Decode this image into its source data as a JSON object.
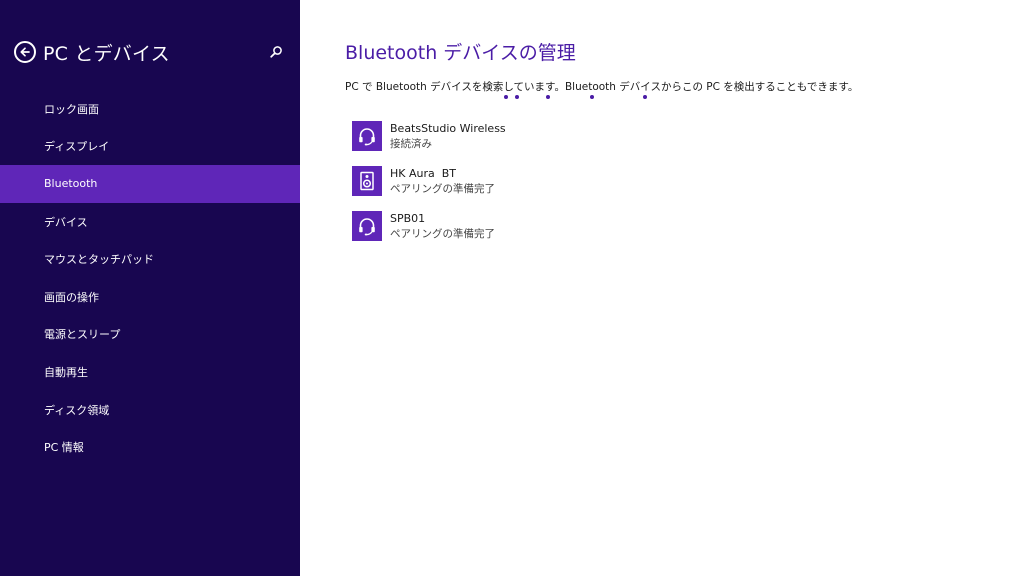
{
  "sidebar": {
    "title": "PC とデバイス",
    "back_icon": "back-arrow-circle-icon",
    "search_icon": "search-icon",
    "items": [
      {
        "label": "ロック画面"
      },
      {
        "label": "ディスプレイ"
      },
      {
        "label": "Bluetooth",
        "selected": true
      },
      {
        "label": "デバイス"
      },
      {
        "label": "マウスとタッチパッド"
      },
      {
        "label": "画面の操作"
      },
      {
        "label": "電源とスリープ"
      },
      {
        "label": "自動再生"
      },
      {
        "label": "ディスク領域"
      },
      {
        "label": "PC 情報"
      }
    ]
  },
  "main": {
    "title": "Bluetooth デバイスの管理",
    "description": "PC で Bluetooth デバイスを検索しています。Bluetooth デバイスからこの PC を検出することもできます。",
    "devices": [
      {
        "name": "BeatsStudio Wireless",
        "status": "接続済み",
        "icon": "headset-icon"
      },
      {
        "name": "HK Aura  BT",
        "status": "ペアリングの準備完了",
        "icon": "speaker-icon"
      },
      {
        "name": "SPB01",
        "status": "ペアリングの準備完了",
        "icon": "headset-icon"
      }
    ]
  },
  "colors": {
    "sidebar_bg": "#180650",
    "accent": "#5f26b8",
    "title_text": "#4a1ca6"
  }
}
